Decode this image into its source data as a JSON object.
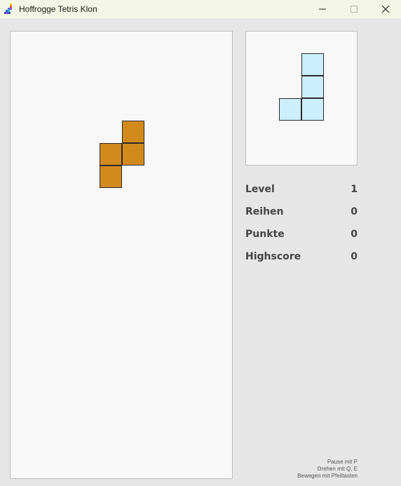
{
  "window": {
    "title": "Hoffrogge Tetris Klon",
    "minimize_icon": "minimize-icon",
    "maximize_icon": "maximize-icon",
    "close_icon": "close-icon"
  },
  "colors": {
    "active_piece": "#d38a1c",
    "next_piece": "#cdeefc",
    "board_bg": "#f8f8f8",
    "window_bg": "#e6e6e6"
  },
  "game": {
    "active_piece_color": "orange",
    "next_piece_color": "light-blue"
  },
  "stats": {
    "level_label": "Level",
    "level_value": "1",
    "rows_label": "Reihen",
    "rows_value": "0",
    "points_label": "Punkte",
    "points_value": "0",
    "highscore_label": "Highscore",
    "highscore_value": "0"
  },
  "help": {
    "pause": "Pause mit P",
    "rotate": "Drehen mit Q, E",
    "move": "Bewegen mit Pfeiltasten"
  }
}
